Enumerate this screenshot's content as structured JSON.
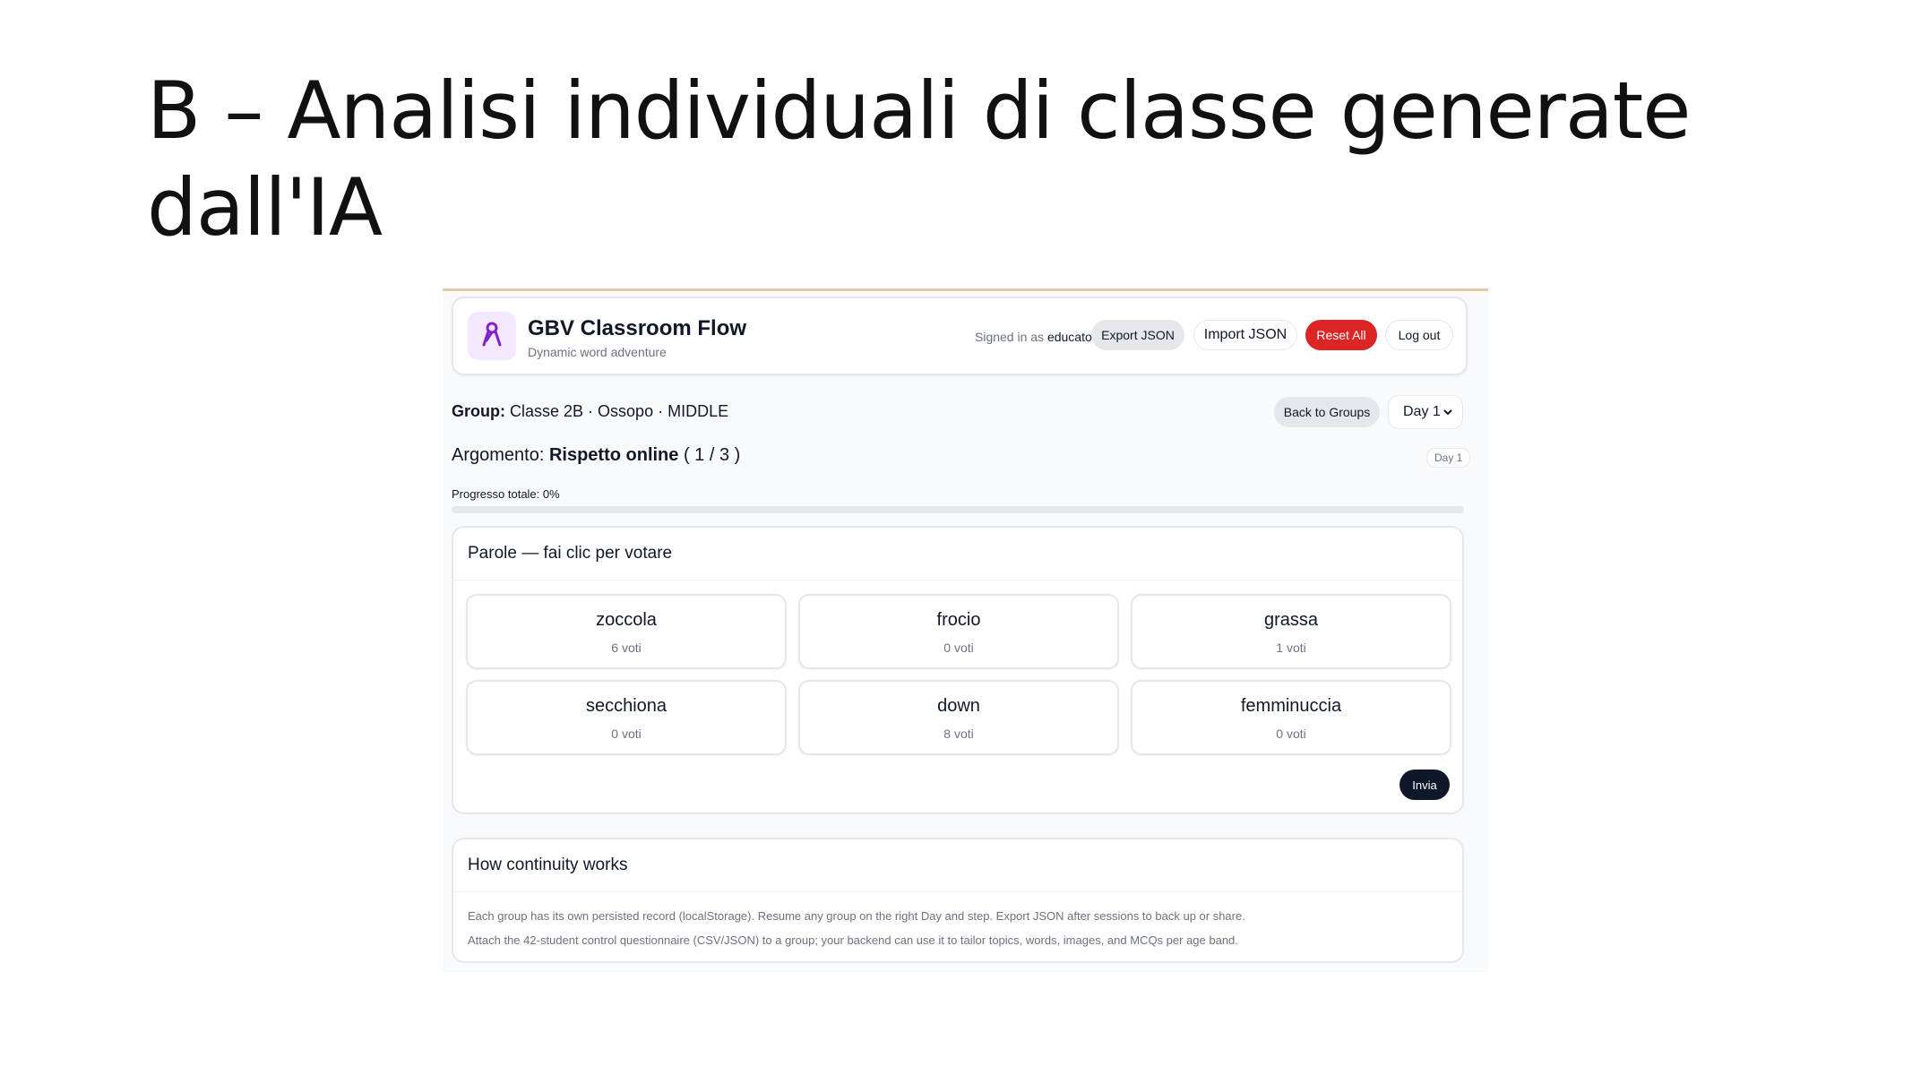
{
  "slide": {
    "title": "B – Analisi individuali di classe generate dall'IA"
  },
  "app": {
    "name": "GBV Classroom Flow",
    "subtitle": "Dynamic word adventure",
    "logo_icon": "ribbon-icon",
    "signed_in_prefix": "Signed in as",
    "signed_in_user": "educator",
    "buttons": {
      "export": "Export JSON",
      "import": "Import JSON",
      "reset": "Reset All",
      "logout": "Log out",
      "back": "Back to Groups"
    },
    "day_select": {
      "value": "Day 1"
    }
  },
  "group": {
    "label": "Group:",
    "value": "Classe 2B · Ossopo · MIDDLE"
  },
  "topic": {
    "label": "Argomento:",
    "name": "Rispetto online",
    "counter": "( 1 / 3 )",
    "day_badge": "Day 1"
  },
  "progress": {
    "label": "Progresso totale: 0%",
    "value": 0
  },
  "vote_card": {
    "title": "Parole — fai clic per votare",
    "words": [
      {
        "word": "zoccola",
        "votes": "6 voti"
      },
      {
        "word": "frocio",
        "votes": "0 voti"
      },
      {
        "word": "grassa",
        "votes": "1 voti"
      },
      {
        "word": "secchiona",
        "votes": "0 voti"
      },
      {
        "word": "down",
        "votes": "8 voti"
      },
      {
        "word": "femminuccia",
        "votes": "0 voti"
      }
    ],
    "submit": "Invia"
  },
  "info_card": {
    "title": "How continuity works",
    "line1": "Each group has its own persisted record (localStorage). Resume any group on the right Day and step. Export JSON after sessions to back up or share.",
    "line2": "Attach the 42-student control questionnaire (CSV/JSON) to a group; your backend can use it to tailor topics, words, images, and MCQs per age band."
  },
  "colors": {
    "accent_purple": "#7e22ce",
    "logo_bg": "#f3e8ff",
    "reset_red": "#dc2626",
    "submit_dark": "#0f172a",
    "top_border": "#e8c7a3"
  }
}
